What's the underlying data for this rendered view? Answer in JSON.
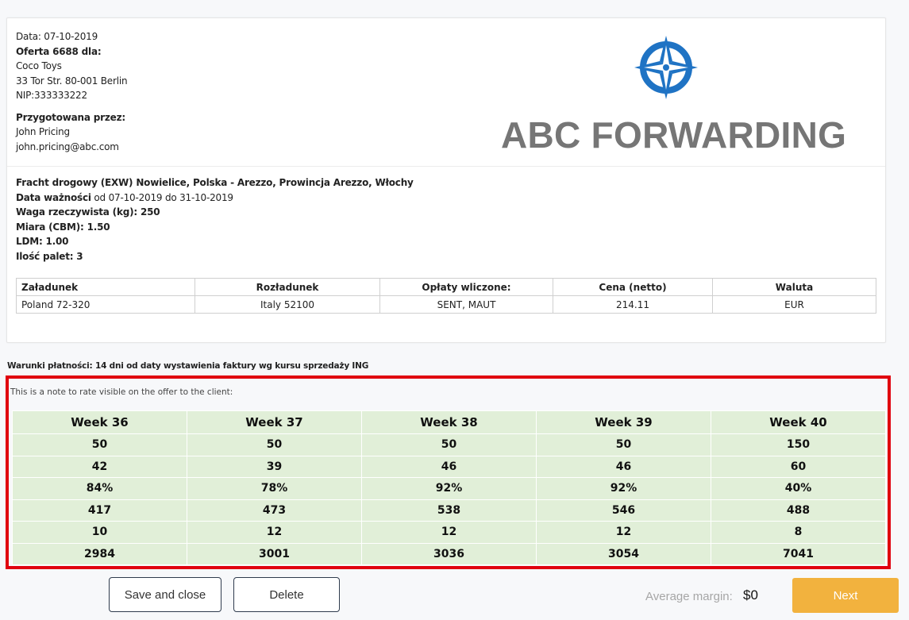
{
  "offer": {
    "date": "Data: 07-10-2019",
    "offer_for": "Oferta 6688 dla:",
    "client_name": "Coco Toys",
    "client_address": "33 Tor Str. 80-001 Berlin",
    "client_nip": "NIP:333333222",
    "prepared_by_label": "Przygotowana przez:",
    "prepared_by_name": "John Pricing",
    "prepared_by_email": "john.pricing@abc.com"
  },
  "logo": {
    "brand": "ABC FORWARDING",
    "icon": "compass-icon",
    "color": "#1f73c4"
  },
  "details": {
    "route": "Fracht drogowy (EXW) Nowielice, Polska - Arezzo, Prowincja Arezzo, Włochy",
    "validity_label": "Data ważności",
    "validity_value": " od 07-10-2019 do 31-10-2019",
    "weight": "Waga rzeczywista (kg): 250",
    "cbm": "Miara (CBM): 1.50",
    "ldm": "LDM: 1.00",
    "pallets": "Ilość palet: 3"
  },
  "rate_table": {
    "headers": [
      "Załadunek",
      "Rozładunek",
      "Opłaty wliczone:",
      "Cena (netto)",
      "Waluta"
    ],
    "row": [
      "Poland 72-320",
      "Italy 52100",
      "SENT, MAUT",
      "214.11",
      "EUR"
    ]
  },
  "payment_terms": "Warunki płatności: 14 dni od daty wystawienia faktury wg kursu sprzedaży ING",
  "note": {
    "text": "This is a note to rate visible on the offer to the client:",
    "headers": [
      "Week 36",
      "Week 37",
      "Week 38",
      "Week 39",
      "Week 40"
    ],
    "rows": [
      [
        "50",
        "50",
        "50",
        "50",
        "150"
      ],
      [
        "42",
        "39",
        "46",
        "46",
        "60"
      ],
      [
        "84%",
        "78%",
        "92%",
        "92%",
        "40%"
      ],
      [
        "417",
        "473",
        "538",
        "546",
        "488"
      ],
      [
        "10",
        "12",
        "12",
        "12",
        "8"
      ],
      [
        "2984",
        "3001",
        "3036",
        "3054",
        "7041"
      ]
    ],
    "cell_color": "#e1efd8",
    "highlight_color": "#e0000e"
  },
  "footer": {
    "save_label": "Save and close",
    "delete_label": "Delete",
    "margin_label": "Average margin:",
    "margin_value": "$0",
    "next_label": "Next",
    "next_color": "#f2b23e"
  }
}
